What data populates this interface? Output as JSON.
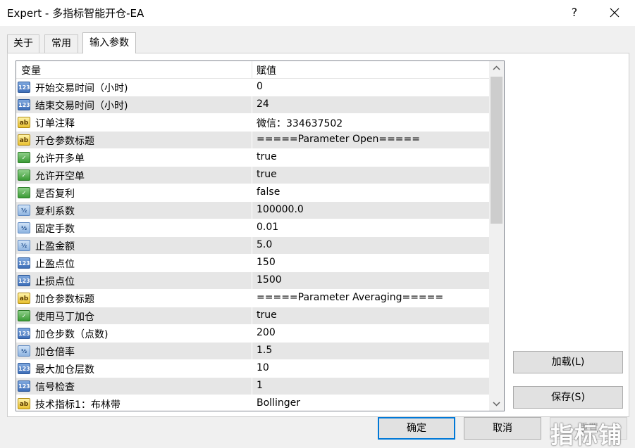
{
  "window": {
    "title": "Expert - 多指标智能开仓-EA",
    "help_label": "?"
  },
  "tabs": [
    {
      "label": "关于"
    },
    {
      "label": "常用"
    },
    {
      "label": "输入参数",
      "active": true
    }
  ],
  "grid": {
    "columns": [
      "变量",
      "赋值"
    ],
    "rows": [
      {
        "icon": "int",
        "icon_text": "123",
        "name": "开始交易时间（小时)",
        "value": "0"
      },
      {
        "icon": "int",
        "icon_text": "123",
        "name": "结束交易时间（小时)",
        "value": "24"
      },
      {
        "icon": "str",
        "icon_text": "ab",
        "name": "订单注释",
        "value": "微信：334637502"
      },
      {
        "icon": "str",
        "icon_text": "ab",
        "name": "开仓参数标题",
        "value": "=====Parameter Open====="
      },
      {
        "icon": "bool",
        "icon_text": "✓",
        "name": "允许开多单",
        "value": "true"
      },
      {
        "icon": "bool",
        "icon_text": "✓",
        "name": "允许开空单",
        "value": "true"
      },
      {
        "icon": "bool",
        "icon_text": "✓",
        "name": "是否复利",
        "value": "false"
      },
      {
        "icon": "dbl",
        "icon_text": "½",
        "name": "复利系数",
        "value": "100000.0"
      },
      {
        "icon": "dbl",
        "icon_text": "½",
        "name": "固定手数",
        "value": "0.01"
      },
      {
        "icon": "dbl",
        "icon_text": "½",
        "name": "止盈金额",
        "value": "5.0"
      },
      {
        "icon": "int",
        "icon_text": "123",
        "name": "止盈点位",
        "value": "150"
      },
      {
        "icon": "int",
        "icon_text": "123",
        "name": "止损点位",
        "value": "1500"
      },
      {
        "icon": "str",
        "icon_text": "ab",
        "name": "加仓参数标题",
        "value": "=====Parameter Averaging====="
      },
      {
        "icon": "bool",
        "icon_text": "✓",
        "name": "使用马丁加仓",
        "value": "true"
      },
      {
        "icon": "int",
        "icon_text": "123",
        "name": "加仓步数（点数)",
        "value": "200"
      },
      {
        "icon": "dbl",
        "icon_text": "½",
        "name": "加仓倍率",
        "value": "1.5"
      },
      {
        "icon": "int",
        "icon_text": "123",
        "name": "最大加仓层数",
        "value": "10"
      },
      {
        "icon": "int",
        "icon_text": "123",
        "name": "信号检查",
        "value": "1"
      },
      {
        "icon": "str",
        "icon_text": "ab",
        "name": "技术指标1：布林带",
        "value": "Bollinger"
      }
    ]
  },
  "buttons": {
    "load": "加载(L)",
    "save": "保存(S)",
    "ok": "确定",
    "cancel": "取消",
    "reset": "重置"
  },
  "watermark": "指标铺"
}
